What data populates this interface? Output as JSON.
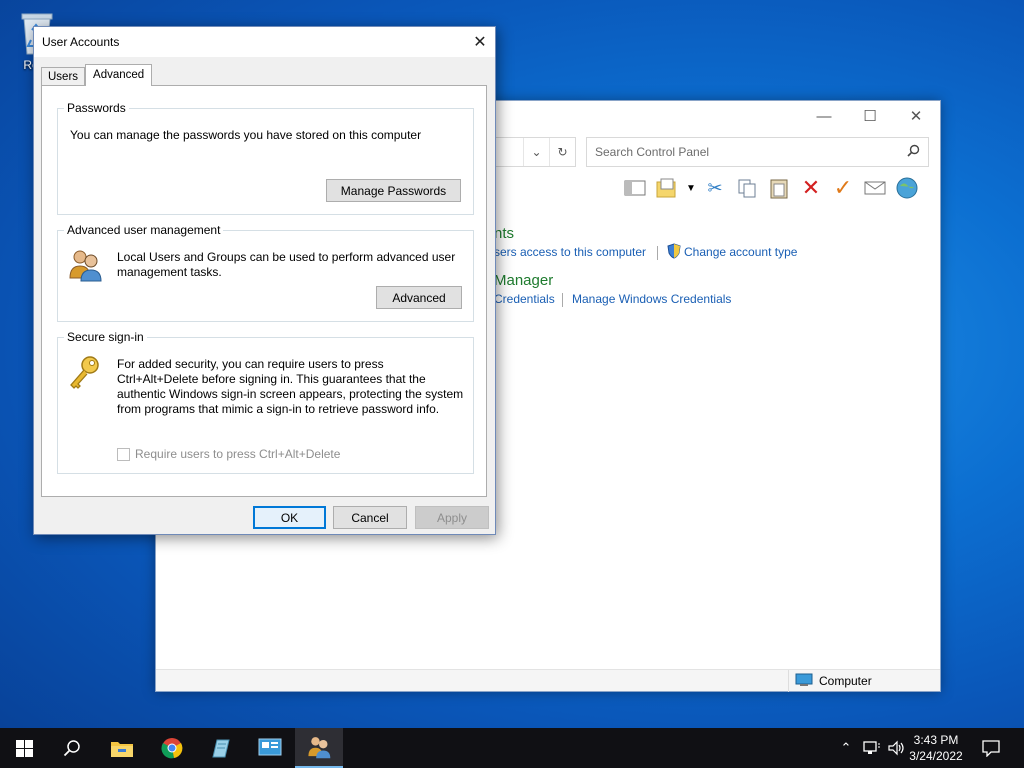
{
  "desktop": {
    "recycle_bin_label": "Recy"
  },
  "control_panel": {
    "search_placeholder": "Search Control Panel",
    "section1_heading": "nts",
    "link_users_access": "sers access to this computer",
    "link_change_account_type": "Change account type",
    "section2_heading": "Manager",
    "link_credentials": "Credentials",
    "link_manage_windows_credentials": "Manage Windows Credentials",
    "status_location": "Computer"
  },
  "dialog": {
    "title": "User Accounts",
    "tabs": [
      {
        "label": "Users",
        "active": false
      },
      {
        "label": "Advanced",
        "active": true
      }
    ],
    "passwords": {
      "legend": "Passwords",
      "text": "You can manage the passwords you have stored on this computer",
      "button": "Manage Passwords"
    },
    "advanced_mgmt": {
      "legend": "Advanced user management",
      "text": "Local Users and Groups can be used to perform advanced user management tasks.",
      "button": "Advanced"
    },
    "secure_signin": {
      "legend": "Secure sign-in",
      "text": "For added security, you can require users to press Ctrl+Alt+Delete before signing in. This guarantees that the authentic Windows sign-in screen appears, protecting the system from programs that mimic a sign-in to retrieve password info.",
      "checkbox_label": "Require users to press Ctrl+Alt+Delete",
      "checked": false
    },
    "buttons": {
      "ok": "OK",
      "cancel": "Cancel",
      "apply": "Apply"
    }
  },
  "taskbar": {
    "time": "3:43 PM",
    "date": "3/24/2022"
  },
  "colors": {
    "accent": "#0078d7",
    "link": "#1a5fb4",
    "heading_green": "#1e7b2e",
    "taskbar": "#101014"
  }
}
